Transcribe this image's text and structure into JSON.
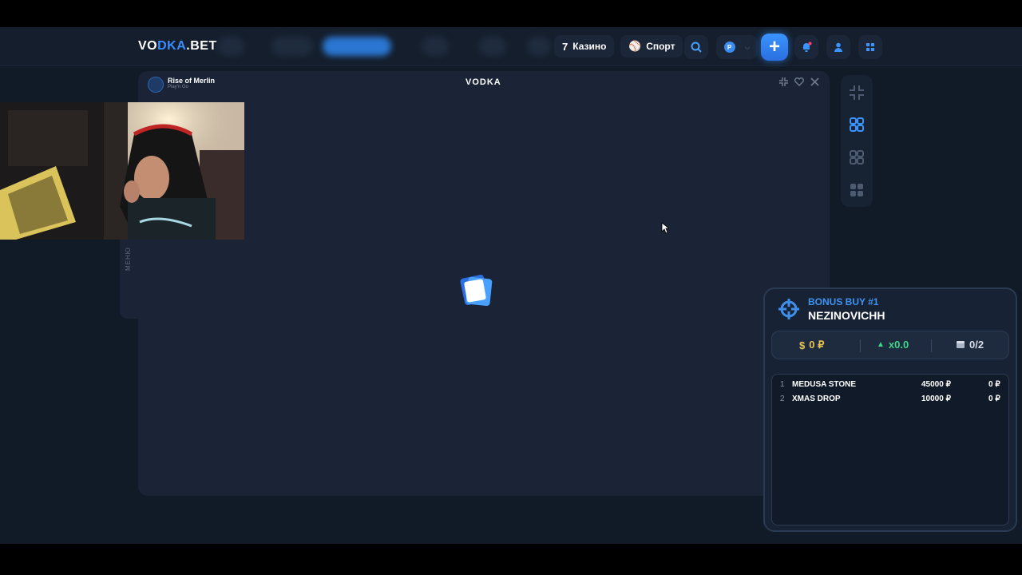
{
  "header": {
    "logo_main": "VO",
    "logo_k": "DKA",
    "logo_tail": ".BET",
    "casino_label": "Казино",
    "sport_label": "Спорт",
    "currency_badge": "P"
  },
  "game": {
    "title": "Rise of Merlin",
    "provider": "Play'n Go",
    "brand": "VODKA",
    "side_menu_label": "МЕНЮ"
  },
  "bonus": {
    "label": "BONUS BUY #1",
    "name": "NEZINOVICHH",
    "total": "0 ₽",
    "multiplier": "x0.0",
    "progress": "0/2",
    "rows": [
      {
        "num": "1",
        "game": "MEDUSA STONE",
        "bet": "45000 ₽",
        "win": "0 ₽"
      },
      {
        "num": "2",
        "game": "XMAS DROP",
        "bet": "10000 ₽",
        "win": "0 ₽"
      }
    ]
  },
  "colors": {
    "accent": "#3a94ff",
    "gold": "#e8c452",
    "green": "#3fd68a",
    "background": "#111a27"
  }
}
